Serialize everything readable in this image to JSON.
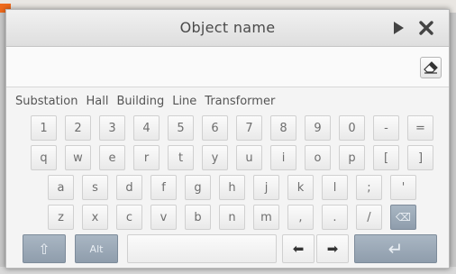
{
  "dialog": {
    "title": "Object name",
    "input_value": "",
    "icons": {
      "play": "play-icon",
      "close": "close-icon",
      "clear": "eraser-icon"
    }
  },
  "suggestions": [
    "Substation",
    "Hall",
    "Building",
    "Line",
    "Transformer"
  ],
  "keyboard": {
    "row1": [
      "1",
      "2",
      "3",
      "4",
      "5",
      "6",
      "7",
      "8",
      "9",
      "0",
      "-",
      "="
    ],
    "row2": [
      "q",
      "w",
      "e",
      "r",
      "t",
      "y",
      "u",
      "i",
      "o",
      "p",
      "[",
      "]"
    ],
    "row3": [
      "a",
      "s",
      "d",
      "f",
      "g",
      "h",
      "j",
      "k",
      "l",
      ";",
      "'"
    ],
    "row4": [
      "z",
      "x",
      "c",
      "v",
      "b",
      "n",
      "m",
      ",",
      ".",
      "/"
    ],
    "special": {
      "shift": "⇧",
      "alt": "Alt",
      "space": "",
      "left_arrow": "⬅",
      "right_arrow": "➡",
      "enter": "↵",
      "backspace": "⌫"
    }
  },
  "colors": {
    "accent_key": "#9aa8b6",
    "dialog_bg": "#f4f4f4",
    "title_text": "#4a4a4a"
  }
}
